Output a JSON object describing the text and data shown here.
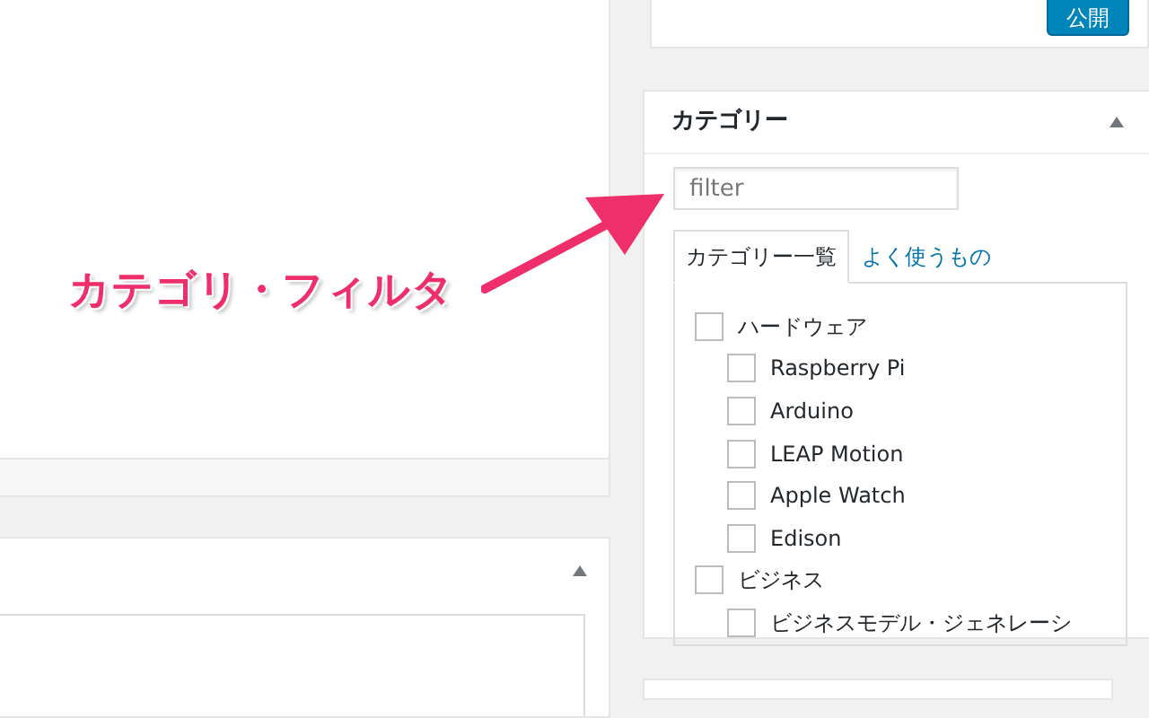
{
  "publish_box": {
    "button": "公開"
  },
  "annotation": {
    "label": "カテゴリ・フィルタ"
  },
  "categories_panel": {
    "title": "カテゴリー",
    "filter": {
      "placeholder": "filter"
    },
    "tabs": [
      {
        "label": "カテゴリー一覧",
        "selected": true
      },
      {
        "label": "よく使うもの",
        "selected": false
      }
    ],
    "categories": [
      {
        "label": "ハードウェア",
        "checked": false,
        "children": [
          {
            "label": "Raspberry Pi",
            "checked": false
          },
          {
            "label": "Arduino",
            "checked": false
          },
          {
            "label": "LEAP Motion",
            "checked": false
          },
          {
            "label": "Apple Watch",
            "checked": false
          },
          {
            "label": "Edison",
            "checked": false
          }
        ]
      },
      {
        "label": "ビジネス",
        "checked": false,
        "children": [
          {
            "label": "ビジネスモデル・ジェネレーシ",
            "checked": false
          }
        ]
      }
    ]
  }
}
